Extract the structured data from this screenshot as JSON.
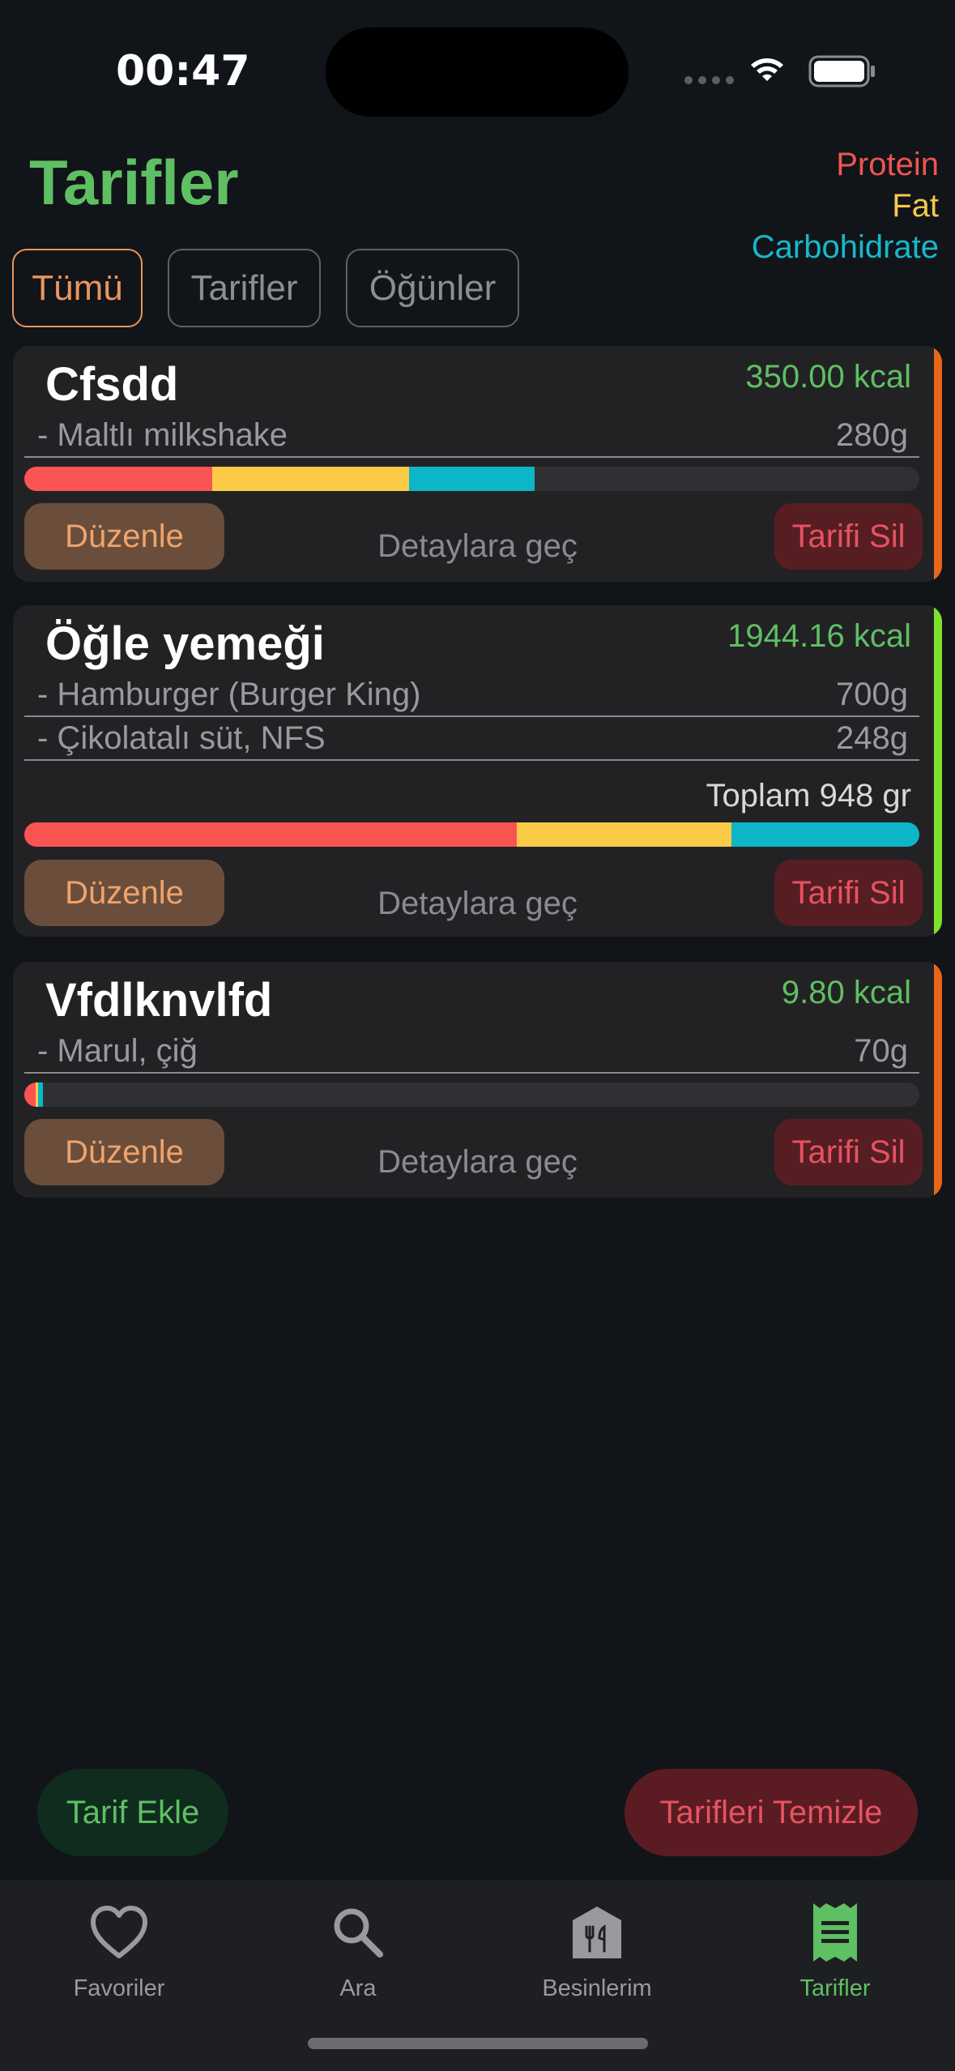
{
  "status": {
    "time": "00:47"
  },
  "header": {
    "title": "Tarifler",
    "legend": {
      "protein": "Protein",
      "fat": "Fat",
      "carb": "Carbohidrate"
    }
  },
  "filters": [
    "Tümü",
    "Tarifler",
    "Öğünler"
  ],
  "actions": {
    "edit": "Düzenle",
    "details": "Detaylara geç",
    "delete": "Tarifi Sil"
  },
  "recipes": [
    {
      "name": "Cfsdd",
      "kcal": "350.00 kcal",
      "ingredients": [
        {
          "name": "- Maltlı milkshake",
          "amount": "280g"
        }
      ],
      "total": "",
      "macros": {
        "protein": 0.21,
        "fat": 0.22,
        "carb": 0.14
      },
      "stripe_color": "#e8661a"
    },
    {
      "name": "Öğle yemeği",
      "kcal": "1944.16 kcal",
      "ingredients": [
        {
          "name": "- Hamburger (Burger King)",
          "amount": "700g"
        },
        {
          "name": "- Çikolatalı süt, NFS",
          "amount": "248g"
        }
      ],
      "total": "Toplam 948 gr",
      "macros": {
        "protein": 0.55,
        "fat": 0.24,
        "carb": 0.21
      },
      "stripe_color": "#7fe12a"
    },
    {
      "name": "Vfdlknvlfd",
      "kcal": "9.80 kcal",
      "ingredients": [
        {
          "name": "- Marul, çiğ",
          "amount": "70g"
        }
      ],
      "total": "",
      "macros": {
        "protein": 0.013,
        "fat": 0.002,
        "carb": 0.006
      },
      "stripe_color": "#e8661a"
    }
  ],
  "bottom": {
    "add": "Tarif Ekle",
    "clear": "Tarifleri Temizle"
  },
  "tabs": [
    {
      "label": "Favoriler",
      "icon": "heart-icon"
    },
    {
      "label": "Ara",
      "icon": "search-icon"
    },
    {
      "label": "Besinlerim",
      "icon": "food-icon"
    },
    {
      "label": "Tarifler",
      "icon": "receipt-icon",
      "active": true
    }
  ],
  "colors": {
    "protein": "#fa5452",
    "fat": "#fbca47",
    "carb": "#0cb6c6",
    "accent": "#5fbf63"
  }
}
